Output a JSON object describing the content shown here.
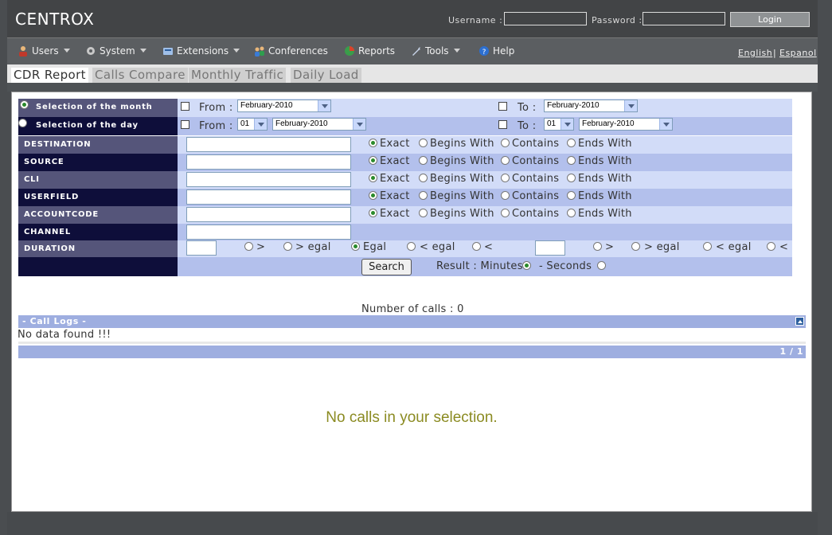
{
  "app": {
    "title": "CENTROX"
  },
  "login": {
    "username_label": "Username :",
    "password_label": "Password :",
    "button": "Login"
  },
  "menu": {
    "items": [
      {
        "label": "Users",
        "icon": "users-icon"
      },
      {
        "label": "System",
        "icon": "gear-icon"
      },
      {
        "label": "Extensions",
        "icon": "phone-icon"
      },
      {
        "label": "Conferences",
        "icon": "conference-icon"
      },
      {
        "label": "Reports",
        "icon": "chart-icon"
      },
      {
        "label": "Tools",
        "icon": "wrench-icon"
      },
      {
        "label": "Help",
        "icon": "help-icon"
      }
    ],
    "lang_english": "English",
    "lang_sep": "|",
    "lang_espanol": "Espanol"
  },
  "tabs": [
    "CDR Report",
    "Calls Compare",
    "Monthly Traffic",
    "Daily Load"
  ],
  "form": {
    "month_label": "Selection of the month",
    "day_label": "Selection of the day",
    "from": "From :",
    "to": "To :",
    "month_value": "February-2010",
    "day_value": "01",
    "fields": [
      "DESTINATION",
      "SOURCE",
      "CLI",
      "USERFIELD",
      "ACCOUNTCODE"
    ],
    "channel": "CHANNEL",
    "duration": "DURATION",
    "match": {
      "exact": "Exact",
      "begins": "Begins With",
      "contains": "Contains",
      "ends": "Ends With"
    },
    "ops": {
      "gt": ">",
      "gte": "> egal",
      "eq": "Egal",
      "lte": "< egal",
      "lt": "<"
    },
    "search_button": "Search",
    "result_label": "Result : Minutes",
    "seconds_label": "- Seconds"
  },
  "results": {
    "count_text": "Number of calls : 0",
    "call_logs_title": "- Call Logs -",
    "no_data": "No data found !!!",
    "pager": "1 / 1",
    "no_calls": "No calls in your selection."
  },
  "colors": {
    "accent_text": "#8b8b22",
    "label_dark": "#0e0e3a",
    "label_mid": "#55557a",
    "row_light": "#d2dcf8",
    "row_mid": "#b3c0ec"
  }
}
